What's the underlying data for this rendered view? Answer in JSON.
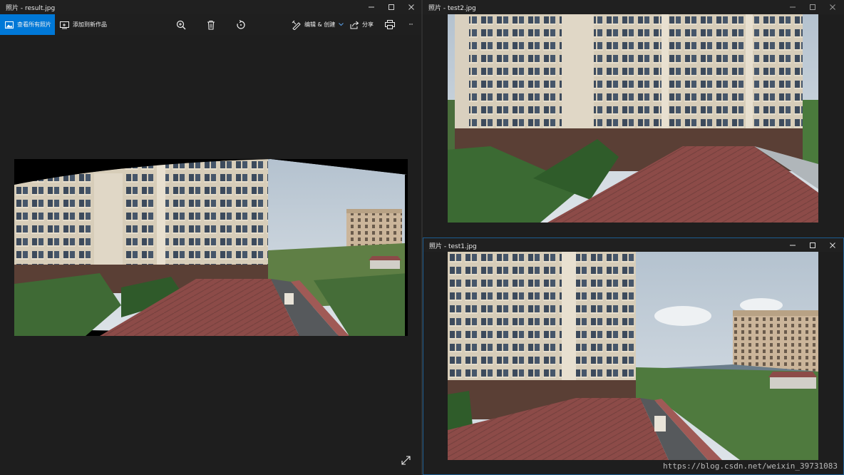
{
  "main_window": {
    "title": "照片 - result.jpg",
    "toolbar": {
      "view_all_label": "查看所有照片",
      "add_to_creation_label": "添加到新作品",
      "edit_create_label": "编辑 & 创建",
      "share_label": "分享",
      "more_label": "···"
    },
    "icons": [
      "photos-icon",
      "add-to-creation-icon",
      "zoom-icon",
      "delete-icon",
      "rotate-icon",
      "edit-icon",
      "chevron-down-icon",
      "share-icon",
      "print-icon",
      "more-icon",
      "fullscreen-icon"
    ]
  },
  "window_test2": {
    "title": "照片 - test2.jpg"
  },
  "window_test1": {
    "title": "照片 - test1.jpg"
  },
  "watermark": "https://blog.csdn.net/weixin_39731083",
  "colors": {
    "accent": "#0078d7",
    "background": "#1f1f1f",
    "active_border": "#1c5c91"
  }
}
